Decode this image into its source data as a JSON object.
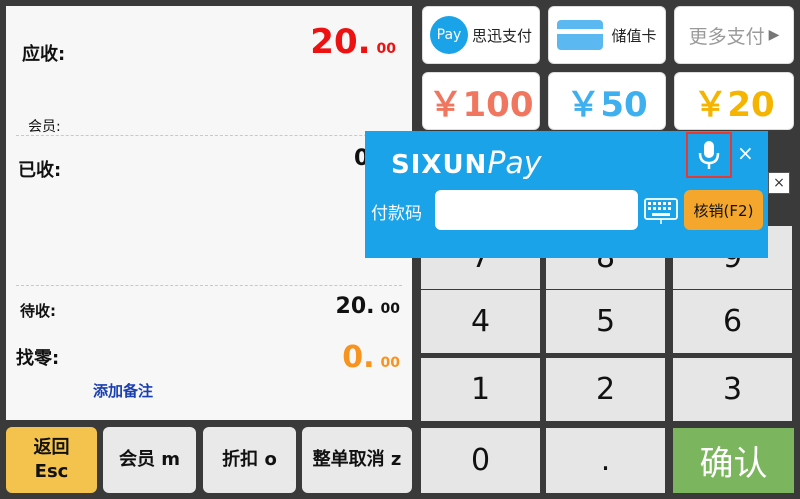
{
  "summary": {
    "receivable_label": "应收:",
    "receivable_int": "20.",
    "receivable_dec": "00",
    "member_label": "会员:",
    "received_label": "已收:",
    "received_int": "0",
    "pending_label": "待收:",
    "pending_int": "20.",
    "pending_dec": "00",
    "change_label": "找零:",
    "change_int": "0.",
    "change_dec": "00",
    "add_note": "添加备注"
  },
  "bottom_buttons": {
    "back_line1": "返回",
    "back_line2": "Esc",
    "member": "会员 m",
    "discount": "折扣 o",
    "cancel_all": "整单取消 z"
  },
  "payments": {
    "sixun_badge": "Pay",
    "sixun_label": "思迅支付",
    "stored_card_label": "储值卡",
    "more_label": "更多支付",
    "cash_100": "￥100",
    "cash_50": "￥50",
    "cash_20": "￥20"
  },
  "keypad": {
    "row1": [
      "7",
      "8",
      "9"
    ],
    "row2": [
      "4",
      "5",
      "6"
    ],
    "row3": [
      "1",
      "2",
      "3"
    ],
    "zero": "0",
    "dot": ".",
    "confirm": "确认"
  },
  "sixunpay": {
    "logo_text": "SIXUN",
    "logo_pay": "Pay",
    "code_label": "付款码",
    "code_value": "",
    "verify_button": "核销(F2)",
    "close": "×"
  },
  "side_close": "×",
  "colors": {
    "receivable": "#ee1111",
    "change": "#f7931e",
    "cash_100": "#f0765f",
    "cash_50": "#3fb0ef",
    "cash_20": "#f5b400",
    "overlay": "#1aa3e8",
    "confirm": "#7bb55e"
  }
}
